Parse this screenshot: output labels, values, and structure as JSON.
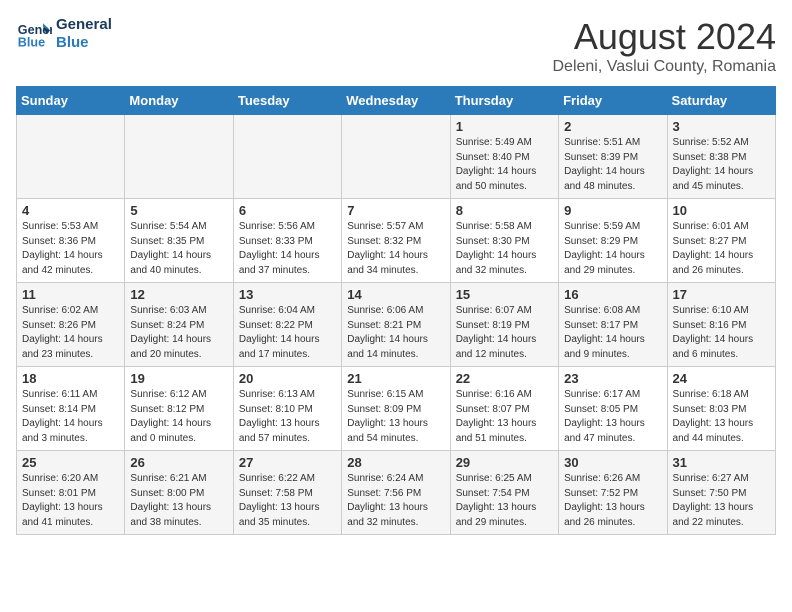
{
  "logo": {
    "line1": "General",
    "line2": "Blue"
  },
  "title": "August 2024",
  "subtitle": "Deleni, Vaslui County, Romania",
  "weekdays": [
    "Sunday",
    "Monday",
    "Tuesday",
    "Wednesday",
    "Thursday",
    "Friday",
    "Saturday"
  ],
  "weeks": [
    [
      {
        "day": "",
        "info": ""
      },
      {
        "day": "",
        "info": ""
      },
      {
        "day": "",
        "info": ""
      },
      {
        "day": "",
        "info": ""
      },
      {
        "day": "1",
        "info": "Sunrise: 5:49 AM\nSunset: 8:40 PM\nDaylight: 14 hours\nand 50 minutes."
      },
      {
        "day": "2",
        "info": "Sunrise: 5:51 AM\nSunset: 8:39 PM\nDaylight: 14 hours\nand 48 minutes."
      },
      {
        "day": "3",
        "info": "Sunrise: 5:52 AM\nSunset: 8:38 PM\nDaylight: 14 hours\nand 45 minutes."
      }
    ],
    [
      {
        "day": "4",
        "info": "Sunrise: 5:53 AM\nSunset: 8:36 PM\nDaylight: 14 hours\nand 42 minutes."
      },
      {
        "day": "5",
        "info": "Sunrise: 5:54 AM\nSunset: 8:35 PM\nDaylight: 14 hours\nand 40 minutes."
      },
      {
        "day": "6",
        "info": "Sunrise: 5:56 AM\nSunset: 8:33 PM\nDaylight: 14 hours\nand 37 minutes."
      },
      {
        "day": "7",
        "info": "Sunrise: 5:57 AM\nSunset: 8:32 PM\nDaylight: 14 hours\nand 34 minutes."
      },
      {
        "day": "8",
        "info": "Sunrise: 5:58 AM\nSunset: 8:30 PM\nDaylight: 14 hours\nand 32 minutes."
      },
      {
        "day": "9",
        "info": "Sunrise: 5:59 AM\nSunset: 8:29 PM\nDaylight: 14 hours\nand 29 minutes."
      },
      {
        "day": "10",
        "info": "Sunrise: 6:01 AM\nSunset: 8:27 PM\nDaylight: 14 hours\nand 26 minutes."
      }
    ],
    [
      {
        "day": "11",
        "info": "Sunrise: 6:02 AM\nSunset: 8:26 PM\nDaylight: 14 hours\nand 23 minutes."
      },
      {
        "day": "12",
        "info": "Sunrise: 6:03 AM\nSunset: 8:24 PM\nDaylight: 14 hours\nand 20 minutes."
      },
      {
        "day": "13",
        "info": "Sunrise: 6:04 AM\nSunset: 8:22 PM\nDaylight: 14 hours\nand 17 minutes."
      },
      {
        "day": "14",
        "info": "Sunrise: 6:06 AM\nSunset: 8:21 PM\nDaylight: 14 hours\nand 14 minutes."
      },
      {
        "day": "15",
        "info": "Sunrise: 6:07 AM\nSunset: 8:19 PM\nDaylight: 14 hours\nand 12 minutes."
      },
      {
        "day": "16",
        "info": "Sunrise: 6:08 AM\nSunset: 8:17 PM\nDaylight: 14 hours\nand 9 minutes."
      },
      {
        "day": "17",
        "info": "Sunrise: 6:10 AM\nSunset: 8:16 PM\nDaylight: 14 hours\nand 6 minutes."
      }
    ],
    [
      {
        "day": "18",
        "info": "Sunrise: 6:11 AM\nSunset: 8:14 PM\nDaylight: 14 hours\nand 3 minutes."
      },
      {
        "day": "19",
        "info": "Sunrise: 6:12 AM\nSunset: 8:12 PM\nDaylight: 14 hours\nand 0 minutes."
      },
      {
        "day": "20",
        "info": "Sunrise: 6:13 AM\nSunset: 8:10 PM\nDaylight: 13 hours\nand 57 minutes."
      },
      {
        "day": "21",
        "info": "Sunrise: 6:15 AM\nSunset: 8:09 PM\nDaylight: 13 hours\nand 54 minutes."
      },
      {
        "day": "22",
        "info": "Sunrise: 6:16 AM\nSunset: 8:07 PM\nDaylight: 13 hours\nand 51 minutes."
      },
      {
        "day": "23",
        "info": "Sunrise: 6:17 AM\nSunset: 8:05 PM\nDaylight: 13 hours\nand 47 minutes."
      },
      {
        "day": "24",
        "info": "Sunrise: 6:18 AM\nSunset: 8:03 PM\nDaylight: 13 hours\nand 44 minutes."
      }
    ],
    [
      {
        "day": "25",
        "info": "Sunrise: 6:20 AM\nSunset: 8:01 PM\nDaylight: 13 hours\nand 41 minutes."
      },
      {
        "day": "26",
        "info": "Sunrise: 6:21 AM\nSunset: 8:00 PM\nDaylight: 13 hours\nand 38 minutes."
      },
      {
        "day": "27",
        "info": "Sunrise: 6:22 AM\nSunset: 7:58 PM\nDaylight: 13 hours\nand 35 minutes."
      },
      {
        "day": "28",
        "info": "Sunrise: 6:24 AM\nSunset: 7:56 PM\nDaylight: 13 hours\nand 32 minutes."
      },
      {
        "day": "29",
        "info": "Sunrise: 6:25 AM\nSunset: 7:54 PM\nDaylight: 13 hours\nand 29 minutes."
      },
      {
        "day": "30",
        "info": "Sunrise: 6:26 AM\nSunset: 7:52 PM\nDaylight: 13 hours\nand 26 minutes."
      },
      {
        "day": "31",
        "info": "Sunrise: 6:27 AM\nSunset: 7:50 PM\nDaylight: 13 hours\nand 22 minutes."
      }
    ]
  ]
}
